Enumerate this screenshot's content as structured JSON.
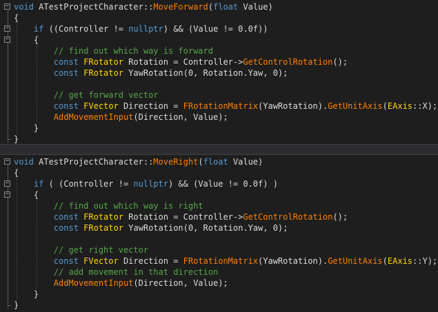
{
  "editor": {
    "theme_colors": {
      "background": "#1e1e1e",
      "keyword": "#569cd6",
      "type": "#ffd700",
      "comment": "#57a64a",
      "function": "#ff8000",
      "text": "#dcdcdc"
    },
    "fold_icons": {
      "collapse": "−"
    },
    "panes": [
      {
        "lines": [
          [
            [
              "kw",
              "void"
            ],
            [
              "tx",
              " ATestProjectCharacter::"
            ],
            [
              "fn",
              "MoveForward"
            ],
            [
              "tx",
              "("
            ],
            [
              "kw",
              "float"
            ],
            [
              "tx",
              " Value)"
            ]
          ],
          [
            [
              "tx",
              "{"
            ]
          ],
          [
            [
              "tx",
              "    "
            ],
            [
              "kw",
              "if"
            ],
            [
              "tx",
              " ((Controller != "
            ],
            [
              "kw",
              "nullptr"
            ],
            [
              "tx",
              ") && (Value != 0.0f))"
            ]
          ],
          [
            [
              "tx",
              "    {"
            ]
          ],
          [
            [
              "cmt",
              "        // find out which way is forward"
            ]
          ],
          [
            [
              "tx",
              "        "
            ],
            [
              "kw",
              "const"
            ],
            [
              "tx",
              " "
            ],
            [
              "ty",
              "FRotator"
            ],
            [
              "tx",
              " Rotation = Controller->"
            ],
            [
              "fn",
              "GetControlRotation"
            ],
            [
              "tx",
              "();"
            ]
          ],
          [
            [
              "tx",
              "        "
            ],
            [
              "kw",
              "const"
            ],
            [
              "tx",
              " "
            ],
            [
              "ty",
              "FRotator"
            ],
            [
              "tx",
              " YawRotation(0, Rotation.Yaw, 0);"
            ]
          ],
          [
            [
              "tx",
              ""
            ]
          ],
          [
            [
              "cmt",
              "        // get forward vector"
            ]
          ],
          [
            [
              "tx",
              "        "
            ],
            [
              "kw",
              "const"
            ],
            [
              "tx",
              " "
            ],
            [
              "ty",
              "FVector"
            ],
            [
              "tx",
              " Direction = "
            ],
            [
              "fn",
              "FRotationMatrix"
            ],
            [
              "tx",
              "(YawRotation)."
            ],
            [
              "fn",
              "GetUnitAxis"
            ],
            [
              "tx",
              "("
            ],
            [
              "ty",
              "EAxis"
            ],
            [
              "tx",
              "::X);"
            ]
          ],
          [
            [
              "tx",
              "        "
            ],
            [
              "fn",
              "AddMovementInput"
            ],
            [
              "tx",
              "(Direction, Value);"
            ]
          ],
          [
            [
              "tx",
              "    }"
            ]
          ],
          [
            [
              "tx",
              "}"
            ]
          ]
        ]
      },
      {
        "lines": [
          [
            [
              "kw",
              "void"
            ],
            [
              "tx",
              " ATestProjectCharacter::"
            ],
            [
              "fn",
              "MoveRight"
            ],
            [
              "tx",
              "("
            ],
            [
              "kw",
              "float"
            ],
            [
              "tx",
              " Value)"
            ]
          ],
          [
            [
              "tx",
              "{"
            ]
          ],
          [
            [
              "tx",
              "    "
            ],
            [
              "kw",
              "if"
            ],
            [
              "tx",
              " ( (Controller != "
            ],
            [
              "kw",
              "nullptr"
            ],
            [
              "tx",
              ") && (Value != 0.0f) )"
            ]
          ],
          [
            [
              "tx",
              "    {"
            ]
          ],
          [
            [
              "cmt",
              "        // find out which way is right"
            ]
          ],
          [
            [
              "tx",
              "        "
            ],
            [
              "kw",
              "const"
            ],
            [
              "tx",
              " "
            ],
            [
              "ty",
              "FRotator"
            ],
            [
              "tx",
              " Rotation = Controller->"
            ],
            [
              "fn",
              "GetControlRotation"
            ],
            [
              "tx",
              "();"
            ]
          ],
          [
            [
              "tx",
              "        "
            ],
            [
              "kw",
              "const"
            ],
            [
              "tx",
              " "
            ],
            [
              "ty",
              "FRotator"
            ],
            [
              "tx",
              " YawRotation(0, Rotation.Yaw, 0);"
            ]
          ],
          [
            [
              "tx",
              ""
            ]
          ],
          [
            [
              "cmt",
              "        // get right vector"
            ]
          ],
          [
            [
              "tx",
              "        "
            ],
            [
              "kw",
              "const"
            ],
            [
              "tx",
              " "
            ],
            [
              "ty",
              "FVector"
            ],
            [
              "tx",
              " Direction = "
            ],
            [
              "fn",
              "FRotationMatrix"
            ],
            [
              "tx",
              "(YawRotation)."
            ],
            [
              "fn",
              "GetUnitAxis"
            ],
            [
              "tx",
              "("
            ],
            [
              "ty",
              "EAxis"
            ],
            [
              "tx",
              "::Y);"
            ]
          ],
          [
            [
              "cmt",
              "        // add movement in that direction"
            ]
          ],
          [
            [
              "tx",
              "        "
            ],
            [
              "fn",
              "AddMovementInput"
            ],
            [
              "tx",
              "(Direction, Value);"
            ]
          ],
          [
            [
              "tx",
              "    }"
            ]
          ],
          [
            [
              "tx",
              "}"
            ]
          ]
        ]
      }
    ]
  }
}
